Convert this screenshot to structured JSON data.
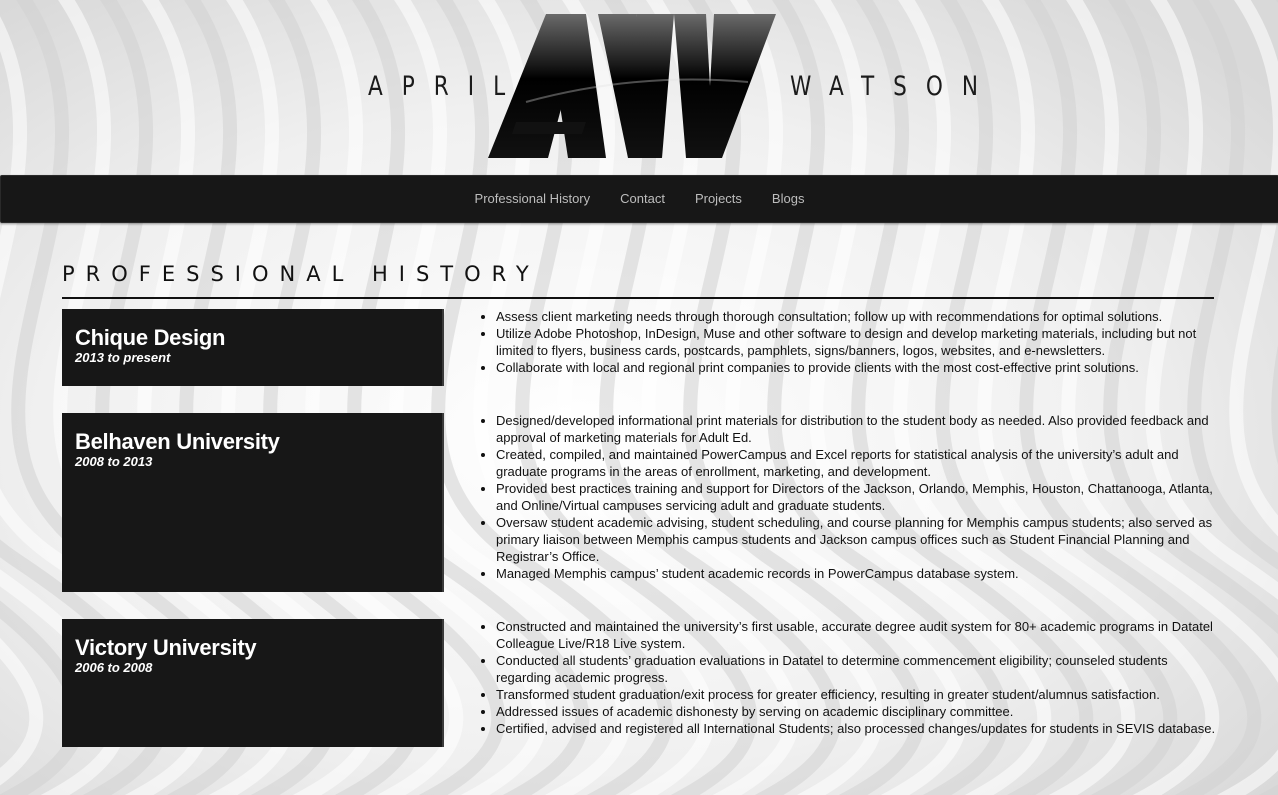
{
  "logo": {
    "first_name": "APRIL",
    "last_name": "WATSON"
  },
  "nav": {
    "items": [
      "Professional History",
      "Contact",
      "Projects",
      "Blogs"
    ]
  },
  "section": {
    "title": "PROFESSIONAL HISTORY"
  },
  "jobs": [
    {
      "company": "Chique Design",
      "dates": "2013 to present",
      "duties": [
        "Assess client marketing needs through thorough consultation; follow up with recommendations for optimal solutions.",
        "Utilize Adobe Photoshop, InDesign, Muse and other software to design and develop marketing materials, including but not limited to flyers, business cards, postcards, pamphlets, signs/banners, logos, websites, and e-newsletters.",
        "Collaborate with local and regional print companies to provide clients with the most cost-effective print solutions."
      ]
    },
    {
      "company": "Belhaven University",
      "dates": "2008 to 2013",
      "duties": [
        "Designed/developed informational print materials for distribution to the student body as needed. Also provided feedback and approval of marketing materials for Adult Ed.",
        "Created, compiled, and maintained PowerCampus and Excel reports for statistical analysis of the university’s adult and graduate programs in the areas of enrollment, marketing, and development.",
        "Provided best practices training and support for Directors of the Jackson, Orlando, Memphis, Houston, Chattanooga, Atlanta, and Online/Virtual campuses servicing adult and graduate students.",
        "Oversaw student academic advising, student scheduling, and course planning for Memphis campus students; also served as primary liaison between Memphis campus students and Jackson campus offices such as Student Financial Planning and Registrar’s Office.",
        "Managed Memphis campus’ student academic records in PowerCampus database system."
      ]
    },
    {
      "company": "Victory University",
      "dates": "2006 to 2008",
      "duties": [
        "Constructed and maintained the university’s first usable, accurate degree audit system for 80+ academic programs in Datatel Colleague Live/R18 Live system.",
        "Conducted all students’ graduation evaluations in Datatel to determine commencement eligibility; counseled students regarding academic progress.",
        "Transformed student graduation/exit process for greater efficiency, resulting in greater student/alumnus satisfaction.",
        "Addressed issues of academic dishonesty by serving on academic disciplinary committee.",
        "Certified, advised and registered all International Students; also processed changes/updates for students in SEVIS database."
      ]
    }
  ]
}
